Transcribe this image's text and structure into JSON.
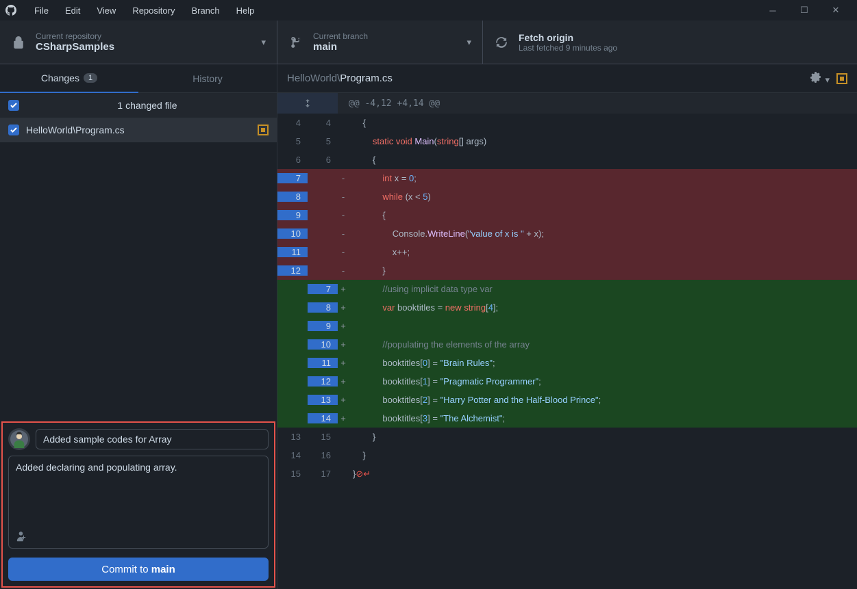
{
  "menu": [
    "File",
    "Edit",
    "View",
    "Repository",
    "Branch",
    "Help"
  ],
  "toolbar": {
    "repo": {
      "label": "Current repository",
      "value": "CSharpSamples"
    },
    "branch": {
      "label": "Current branch",
      "value": "main"
    },
    "fetch": {
      "label": "Fetch origin",
      "value": "Last fetched 9 minutes ago"
    }
  },
  "tabs": {
    "changes": "Changes",
    "changes_count": "1",
    "history": "History"
  },
  "filelist": {
    "header": "1 changed file",
    "file": "HelloWorld\\Program.cs"
  },
  "commit": {
    "summary": "Added sample codes for Array",
    "description": "Added declaring and populating array.",
    "button_prefix": "Commit to ",
    "button_branch": "main"
  },
  "diff": {
    "path_prefix": "HelloWorld\\",
    "path_file": "Program.cs",
    "hunk": "@@ -4,12 +4,14 @@",
    "lines": [
      {
        "t": "ctx",
        "a": "4",
        "b": "4",
        "code": "    {"
      },
      {
        "t": "ctx",
        "a": "5",
        "b": "5",
        "code_html": "        <span class='tk-key'>static</span> <span class='tk-key'>void</span> <span class='tk-fn'>Main</span>(<span class='tk-key'>string</span>[] <span class='tk-var'>args</span>)"
      },
      {
        "t": "ctx",
        "a": "6",
        "b": "6",
        "code": "        {"
      },
      {
        "t": "del",
        "a": "7",
        "b": "",
        "code_html": "            <span class='tk-key'>int</span> <span class='tk-var'>x</span> = <span class='tk-num'>0</span>;"
      },
      {
        "t": "del",
        "a": "8",
        "b": "",
        "code_html": "            <span class='tk-key'>while</span> (<span class='tk-var'>x</span> &lt; <span class='tk-num'>5</span>)"
      },
      {
        "t": "del",
        "a": "9",
        "b": "",
        "code": "            {"
      },
      {
        "t": "del",
        "a": "10",
        "b": "",
        "code_html": "                <span class='tk-var'>Console</span>.<span class='tk-fn'>WriteLine</span>(<span class='tk-str'>\"value of x is \"</span> + <span class='tk-var'>x</span>);"
      },
      {
        "t": "del",
        "a": "11",
        "b": "",
        "code_html": "                <span class='tk-var'>x</span>++;"
      },
      {
        "t": "del",
        "a": "12",
        "b": "",
        "code": "            }"
      },
      {
        "t": "add",
        "a": "",
        "b": "7",
        "code_html": "            <span class='tk-com'>//using implicit data type var</span>"
      },
      {
        "t": "add",
        "a": "",
        "b": "8",
        "code_html": "            <span class='tk-key'>var</span> <span class='tk-var'>booktitles</span> = <span class='tk-key'>new</span> <span class='tk-key'>string</span>[<span class='tk-num'>4</span>];"
      },
      {
        "t": "add",
        "a": "",
        "b": "9",
        "code": ""
      },
      {
        "t": "add",
        "a": "",
        "b": "10",
        "code_html": "            <span class='tk-com'>//populating the elements of the array</span>"
      },
      {
        "t": "add",
        "a": "",
        "b": "11",
        "code_html": "            <span class='tk-var'>booktitles</span>[<span class='tk-num'>0</span>] = <span class='tk-str'>\"Brain Rules\"</span>;"
      },
      {
        "t": "add",
        "a": "",
        "b": "12",
        "code_html": "            <span class='tk-var'>booktitles</span>[<span class='tk-num'>1</span>] = <span class='tk-str'>\"Pragmatic Programmer\"</span>;"
      },
      {
        "t": "add",
        "a": "",
        "b": "13",
        "code_html": "            <span class='tk-var'>booktitles</span>[<span class='tk-num'>2</span>] = <span class='tk-str'>\"Harry Potter and the Half-Blood Prince\"</span>;"
      },
      {
        "t": "add",
        "a": "",
        "b": "14",
        "code_html": "            <span class='tk-var'>booktitles</span>[<span class='tk-num'>3</span>] = <span class='tk-str'>\"The Alchemist\"</span>;"
      },
      {
        "t": "ctx",
        "a": "13",
        "b": "15",
        "code": "        }"
      },
      {
        "t": "ctx",
        "a": "14",
        "b": "16",
        "code": "    }"
      },
      {
        "t": "ctx",
        "a": "15",
        "b": "17",
        "code_html": "}<span class='tk-err'>⊘↵</span>"
      }
    ]
  }
}
